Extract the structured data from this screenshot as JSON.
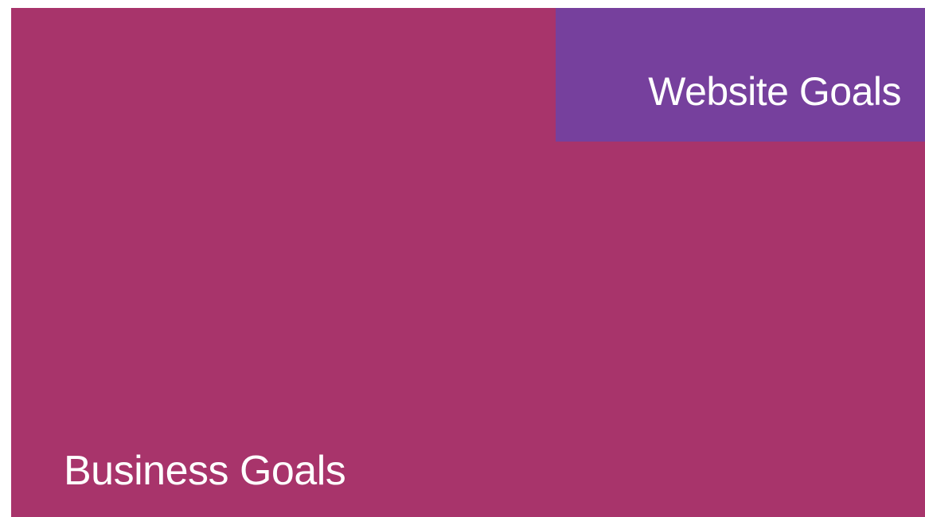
{
  "diagram": {
    "outer_box": {
      "label": "Business Goals",
      "color": "#a8346b"
    },
    "inner_box": {
      "label": "Website Goals",
      "color": "#76409d"
    },
    "text_color": "#ffffff"
  }
}
